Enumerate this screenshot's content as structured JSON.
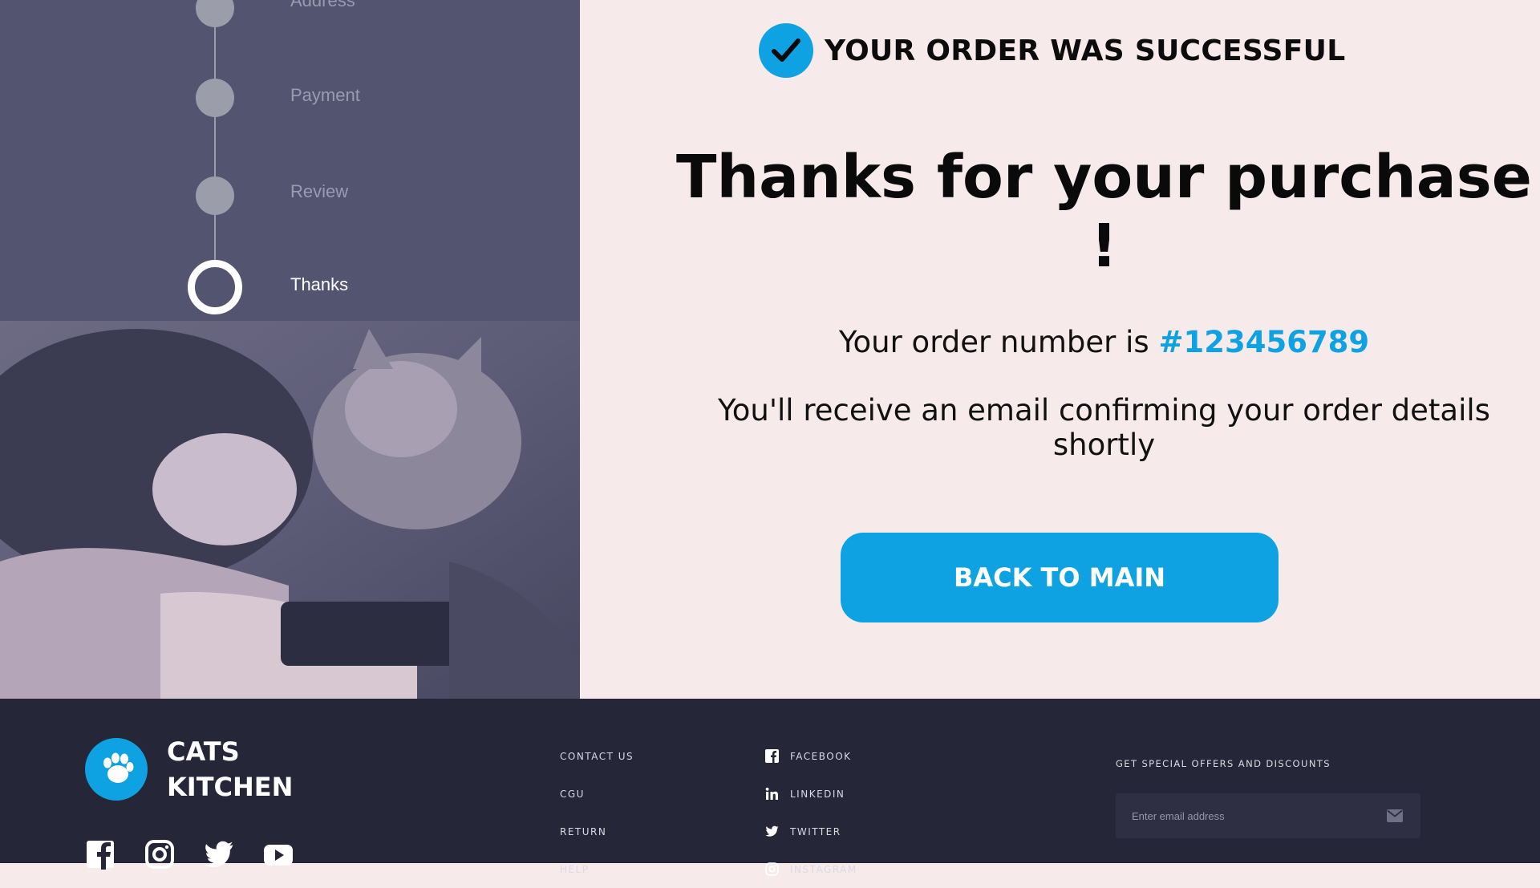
{
  "steps": [
    {
      "label": "Address",
      "state": "done"
    },
    {
      "label": "Payment",
      "state": "done"
    },
    {
      "label": "Review",
      "state": "done"
    },
    {
      "label": "Thanks",
      "state": "active"
    }
  ],
  "success": {
    "headline": "YOUR ORDER WAS SUCCESSFUL",
    "title": "Thanks for your purchase !",
    "order_prefix": "Your order number is ",
    "order_number": "#123456789",
    "email_note": "You'll receive an email confirming your order details shortly",
    "back_button": "BACK TO MAIN"
  },
  "footer": {
    "brand_line1": "CATS",
    "brand_line2": "KITCHEN",
    "social_icons": [
      "facebook-icon",
      "instagram-icon",
      "twitter-icon",
      "youtube-icon"
    ],
    "links": [
      "CONTACT US",
      "CGU",
      "RETURN",
      "HELP"
    ],
    "social_links": [
      "FACEBOOK",
      "LINKEDIN",
      "TWITTER",
      "INSTAGRAM"
    ],
    "newsletter_title": "GET SPECIAL OFFERS AND DISCOUNTS",
    "newsletter_placeholder": "Enter email address"
  },
  "colors": {
    "accent": "#0fa2e2",
    "left_panel": "#525470",
    "right_panel": "#f6eaea",
    "footer": "#252638"
  }
}
